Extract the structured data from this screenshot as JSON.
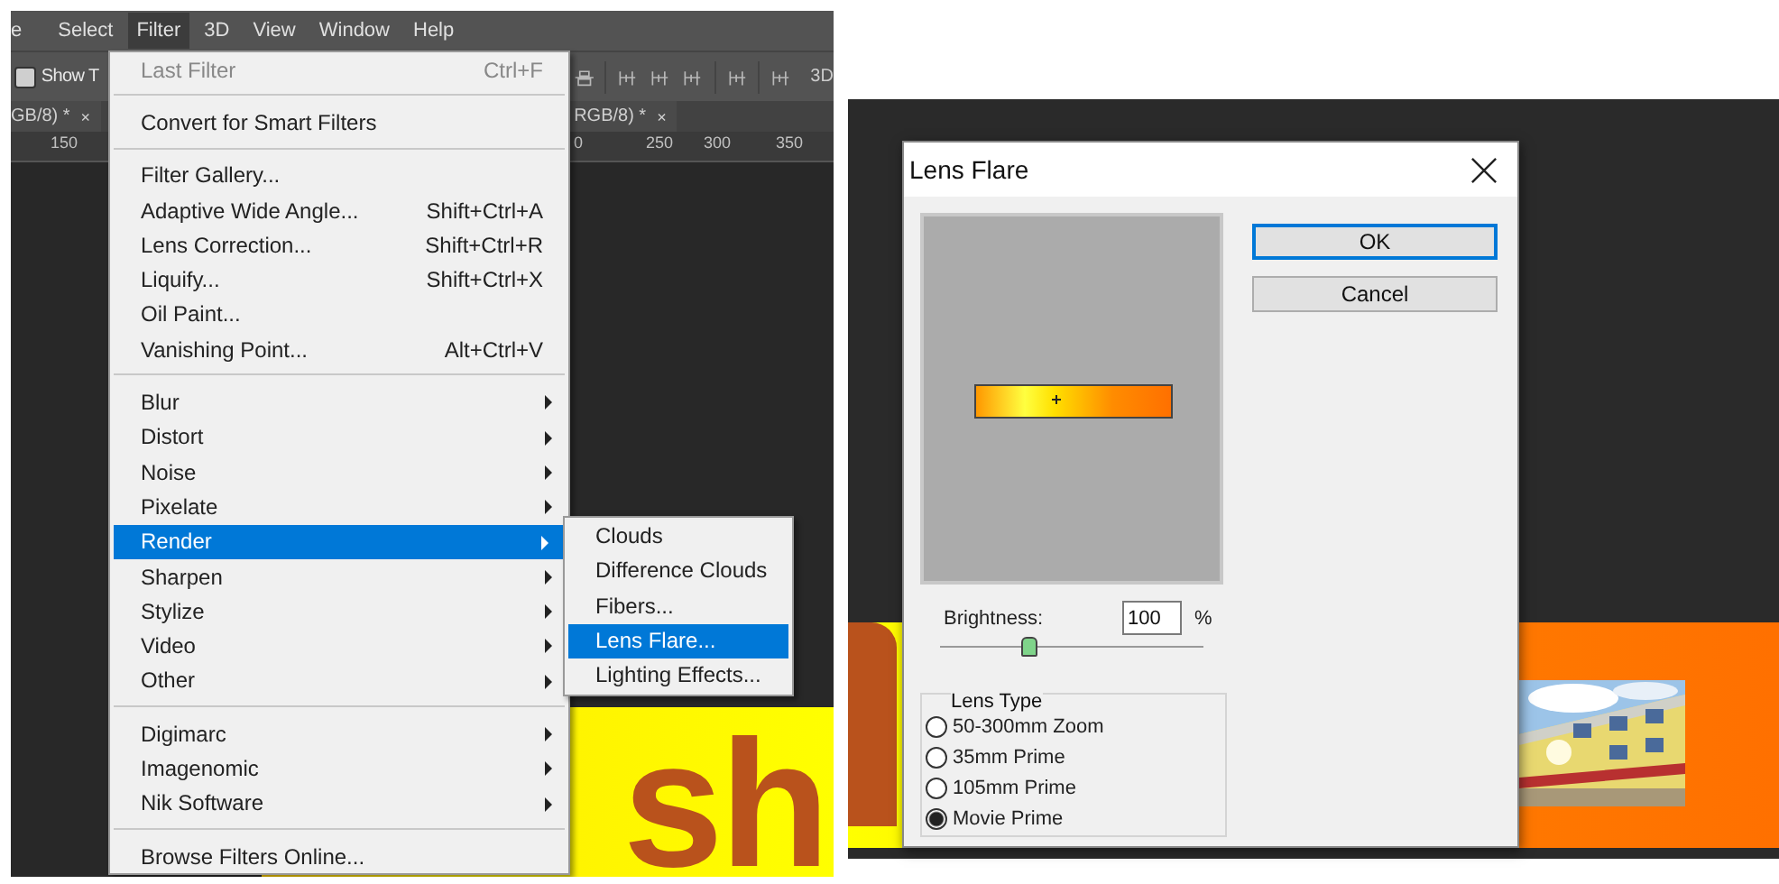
{
  "left_screen": {
    "menu_bar": [
      {
        "label": "e",
        "selected": false
      },
      {
        "label": "Select",
        "selected": false
      },
      {
        "label": "Filter",
        "selected": true
      },
      {
        "label": "3D",
        "selected": false
      },
      {
        "label": "View",
        "selected": false
      },
      {
        "label": "Window",
        "selected": false
      },
      {
        "label": "Help",
        "selected": false
      }
    ],
    "options_bar": {
      "checkbox": {
        "label": "Show T",
        "checked": false
      },
      "extra_text": "3D"
    },
    "document_tabs": [
      {
        "title": "GB/8) *",
        "close": "×"
      },
      {
        "title": "RGB/8) *",
        "close": "×"
      }
    ],
    "ruler": [
      "150",
      "0",
      "250",
      "300",
      "350"
    ],
    "canvas_text": "sh",
    "filter_menu": [
      [
        {
          "label": "Last Filter",
          "shortcut": "Ctrl+F",
          "disabled": true,
          "submenu": false,
          "selected": false
        }
      ],
      [
        {
          "label": "Convert for Smart Filters",
          "disabled": false,
          "submenu": false,
          "selected": false
        }
      ],
      [
        {
          "label": "Filter Gallery...",
          "disabled": false,
          "submenu": false,
          "selected": false
        },
        {
          "label": "Adaptive Wide Angle...",
          "shortcut": "Shift+Ctrl+A",
          "disabled": false,
          "submenu": false,
          "selected": false
        },
        {
          "label": "Lens Correction...",
          "shortcut": "Shift+Ctrl+R",
          "disabled": false,
          "submenu": false,
          "selected": false
        },
        {
          "label": "Liquify...",
          "shortcut": "Shift+Ctrl+X",
          "disabled": false,
          "submenu": false,
          "selected": false
        },
        {
          "label": "Oil Paint...",
          "disabled": false,
          "submenu": false,
          "selected": false
        },
        {
          "label": "Vanishing Point...",
          "shortcut": "Alt+Ctrl+V",
          "disabled": false,
          "submenu": false,
          "selected": false
        }
      ],
      [
        {
          "label": "Blur",
          "disabled": false,
          "submenu": true,
          "selected": false
        },
        {
          "label": "Distort",
          "disabled": false,
          "submenu": true,
          "selected": false
        },
        {
          "label": "Noise",
          "disabled": false,
          "submenu": true,
          "selected": false
        },
        {
          "label": "Pixelate",
          "disabled": false,
          "submenu": true,
          "selected": false
        },
        {
          "label": "Render",
          "disabled": false,
          "submenu": true,
          "selected": true
        },
        {
          "label": "Sharpen",
          "disabled": false,
          "submenu": true,
          "selected": false
        },
        {
          "label": "Stylize",
          "disabled": false,
          "submenu": true,
          "selected": false
        },
        {
          "label": "Video",
          "disabled": false,
          "submenu": true,
          "selected": false
        },
        {
          "label": "Other",
          "disabled": false,
          "submenu": true,
          "selected": false
        }
      ],
      [
        {
          "label": "Digimarc",
          "disabled": false,
          "submenu": true,
          "selected": false
        },
        {
          "label": "Imagenomic",
          "disabled": false,
          "submenu": true,
          "selected": false
        },
        {
          "label": "Nik Software",
          "disabled": false,
          "submenu": true,
          "selected": false
        }
      ],
      [
        {
          "label": "Browse Filters Online...",
          "disabled": false,
          "submenu": false,
          "selected": false
        }
      ]
    ],
    "render_submenu": [
      {
        "label": "Clouds",
        "selected": false
      },
      {
        "label": "Difference Clouds",
        "selected": false
      },
      {
        "label": "Fibers...",
        "selected": false
      },
      {
        "label": "Lens Flare...",
        "selected": true
      },
      {
        "label": "Lighting Effects...",
        "selected": false
      }
    ]
  },
  "lens_flare_dialog": {
    "title": "Lens Flare",
    "buttons": [
      {
        "label": "OK",
        "default": true
      },
      {
        "label": "Cancel",
        "default": false
      }
    ],
    "brightness": {
      "label": "Brightness:",
      "value": "100",
      "unit": "%",
      "level": 0.33
    },
    "lens_type": {
      "title": "Lens Type",
      "options": [
        {
          "label": "50-300mm Zoom",
          "selected": false
        },
        {
          "label": "35mm Prime",
          "selected": false
        },
        {
          "label": "105mm Prime",
          "selected": false
        },
        {
          "label": "Movie Prime",
          "selected": true
        }
      ]
    }
  }
}
